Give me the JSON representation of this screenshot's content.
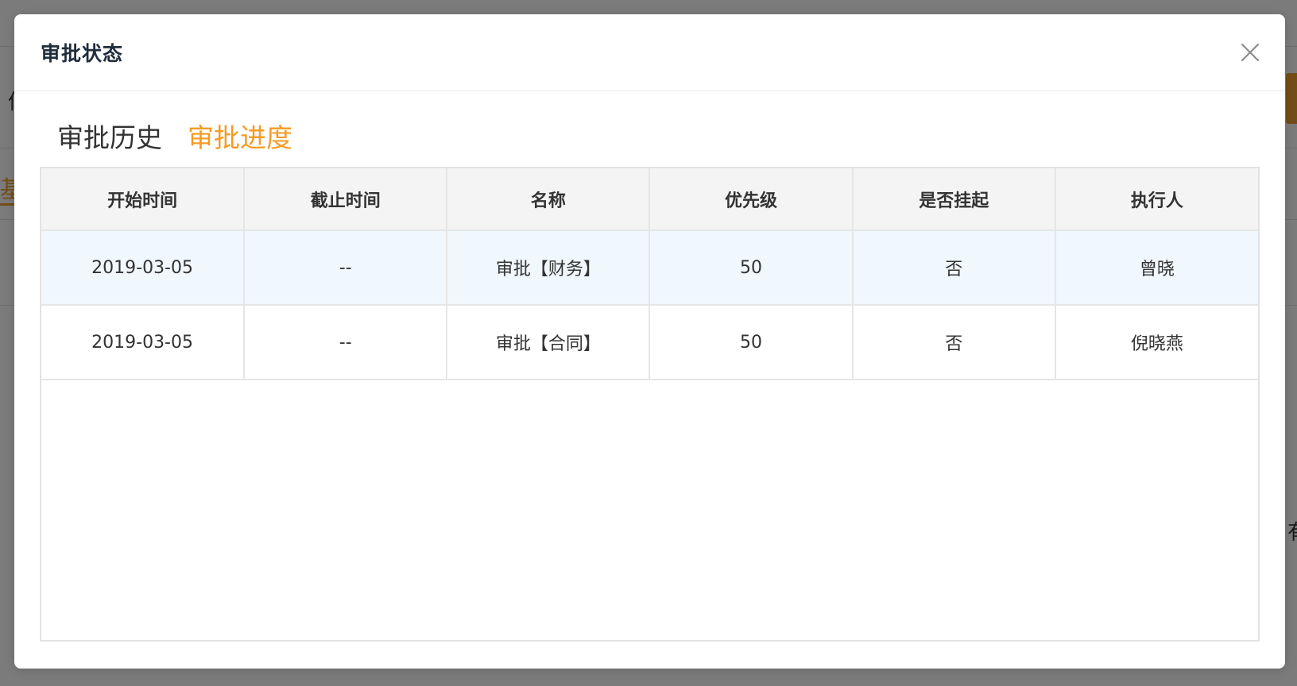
{
  "background": {
    "chars": [
      "信",
      "基",
      "有"
    ]
  },
  "modal": {
    "title": "审批状态",
    "close_icon": "close-icon"
  },
  "tabs": [
    {
      "label": "审批历史",
      "active": false
    },
    {
      "label": "审批进度",
      "active": true
    }
  ],
  "colors": {
    "accent": "#f59a23",
    "row_highlight": "#f0f7fd",
    "header_bg": "#f4f4f4"
  },
  "table": {
    "columns": [
      "开始时间",
      "截止时间",
      "名称",
      "优先级",
      "是否挂起",
      "执行人"
    ],
    "rows": [
      [
        "2019-03-05",
        "--",
        "审批【财务】",
        "50",
        "否",
        "曾晓"
      ],
      [
        "2019-03-05",
        "--",
        "审批【合同】",
        "50",
        "否",
        "倪晓燕"
      ]
    ]
  }
}
